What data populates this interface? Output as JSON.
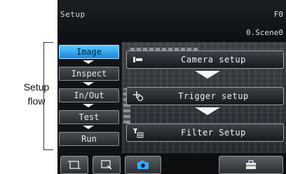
{
  "annotation": {
    "label": "Setup\nflow"
  },
  "header": {
    "title": "Setup",
    "function_code": "F0",
    "scene": "0.Scene0"
  },
  "flow": {
    "steps": [
      {
        "label": "Image",
        "active": true
      },
      {
        "label": "Inspect",
        "active": false
      },
      {
        "label": "In/Out",
        "active": false
      },
      {
        "label": "Test",
        "active": false
      },
      {
        "label": "Run",
        "active": false
      }
    ]
  },
  "setup_buttons": [
    {
      "label": "Camera setup",
      "icon": "camera-setup-icon"
    },
    {
      "label": "Trigger setup",
      "icon": "trigger-setup-icon"
    },
    {
      "label": "Filter Setup",
      "icon": "filter-setup-icon"
    }
  ],
  "toolbar": {
    "buttons": [
      {
        "icon": "frame-icon"
      },
      {
        "icon": "zoom-icon"
      },
      {
        "icon": "camera-icon"
      },
      {
        "icon": "toolbox-icon"
      }
    ]
  },
  "colors": {
    "active_step": "#2aa0ee",
    "screen_bg": "#101417",
    "camera_icon": "#3aa7ff"
  }
}
